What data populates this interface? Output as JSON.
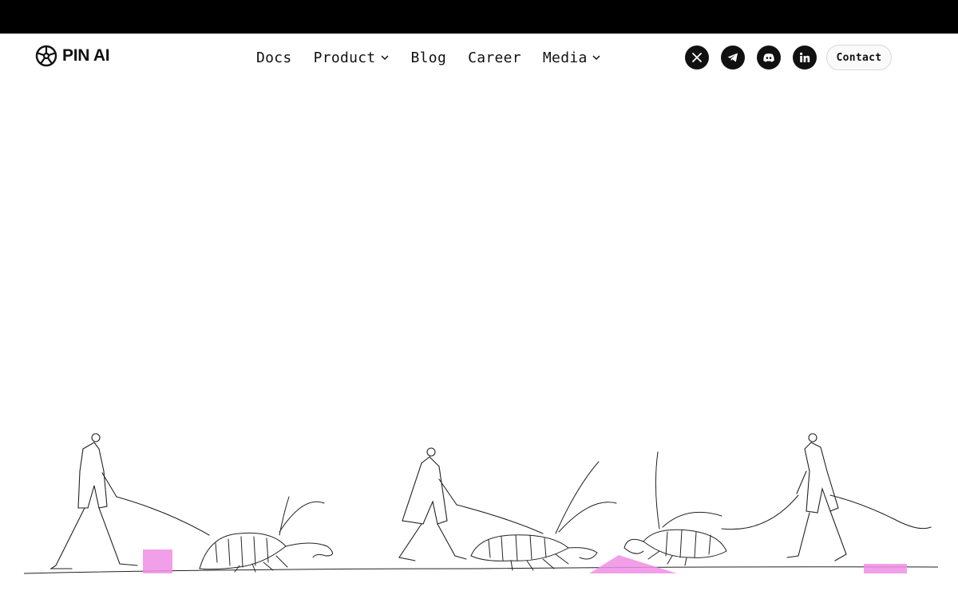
{
  "brand": {
    "name": "PIN AI",
    "logo_icon": "wheel-icon"
  },
  "nav": {
    "items": [
      {
        "label": "Docs",
        "has_dropdown": false
      },
      {
        "label": "Product",
        "has_dropdown": true
      },
      {
        "label": "Blog",
        "has_dropdown": false
      },
      {
        "label": "Career",
        "has_dropdown": false
      },
      {
        "label": "Media",
        "has_dropdown": true
      }
    ]
  },
  "socials": [
    {
      "name": "x-icon"
    },
    {
      "name": "telegram-icon"
    },
    {
      "name": "discord-icon"
    },
    {
      "name": "linkedin-icon"
    }
  ],
  "contact": {
    "label": "Contact"
  },
  "colors": {
    "top_bar": "#000000",
    "background": "#ffffff",
    "accent_pink": "#f08ee6",
    "ink": "#111111"
  }
}
